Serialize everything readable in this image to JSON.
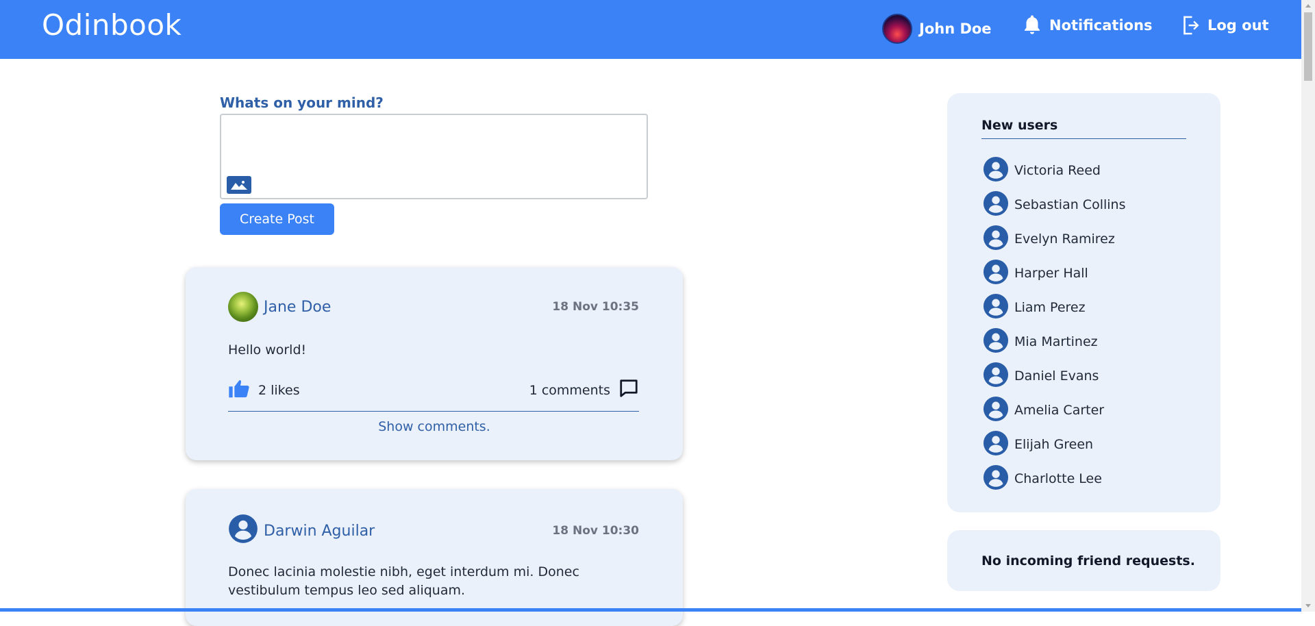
{
  "header": {
    "brand": "Odinbook",
    "user_name": "John Doe",
    "notifications_label": "Notifications",
    "logout_label": "Log out"
  },
  "composer": {
    "label": "Whats on your mind?",
    "placeholder": "",
    "button_label": "Create Post"
  },
  "posts": [
    {
      "author": "Jane Doe",
      "time": "18 Nov 10:35",
      "body": "Hello world!",
      "likes": "2 likes",
      "comments": "1 comments",
      "show_comments": "Show comments."
    },
    {
      "author": "Darwin Aguilar",
      "time": "18 Nov 10:30",
      "body": "Donec lacinia molestie nibh, eget interdum mi. Donec vestibulum tempus leo sed aliquam."
    }
  ],
  "new_users": {
    "title": "New users",
    "users": [
      "Victoria Reed",
      "Sebastian Collins",
      "Evelyn Ramirez",
      "Harper Hall",
      "Liam Perez",
      "Mia Martinez",
      "Daniel Evans",
      "Amelia Carter",
      "Elijah Green",
      "Charlotte Lee"
    ]
  },
  "friend_requests": {
    "text": "No incoming friend requests."
  },
  "colors": {
    "primary": "#3b82f6",
    "accent_dark": "#2a5da8",
    "card_bg": "#eaf1fb"
  }
}
